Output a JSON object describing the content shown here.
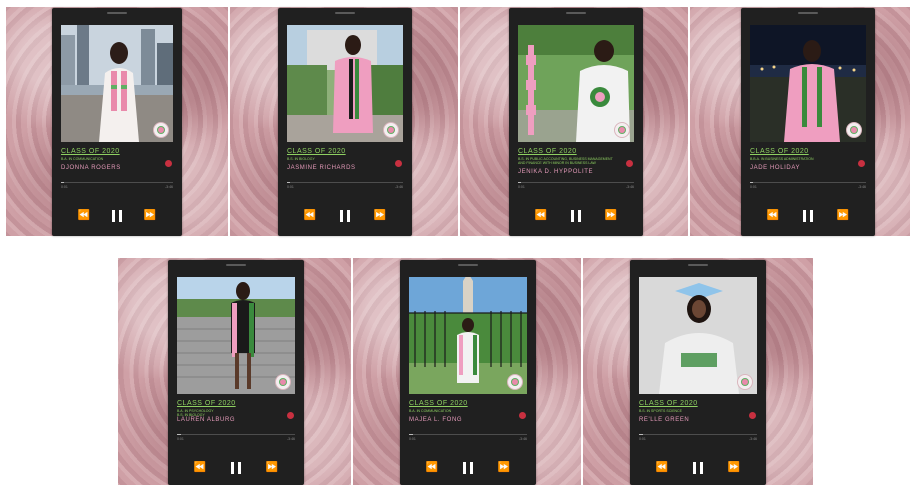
{
  "colors": {
    "accent_green": "#8ed061",
    "accent_pink": "#e39ab9",
    "player_background": "#202020",
    "record_dot": "#c83040"
  },
  "icons": {
    "previous": "⏪",
    "pause": "pause-icon",
    "next": "⏩",
    "record": "record-icon",
    "crest": "sorority-crest-icon"
  },
  "cards": [
    {
      "class_label": "CLASS OF 2020",
      "degree": "B.A. IN COMMUNICATION",
      "name": "DJONNA ROGERS",
      "time_elapsed": "0:01",
      "time_remaining": "-3:46",
      "progress": 0.03
    },
    {
      "class_label": "CLASS OF 2020",
      "degree": "B.S. IN BIOLOGY",
      "name": "JASMINE RICHARDS",
      "time_elapsed": "0:01",
      "time_remaining": "-3:46",
      "progress": 0.03
    },
    {
      "class_label": "CLASS OF 2020",
      "degree": "B.S. IN PUBLIC ACCOUNTING, BUSINESS MANAGEMENT\nAND FINANCE WITH MINOR IN BUSINESS LAW",
      "name": "JENIKA D. HYPPOLITE",
      "time_elapsed": "0:01",
      "time_remaining": "-3:46",
      "progress": 0.03
    },
    {
      "class_label": "CLASS OF 2020",
      "degree": "B.B.A. IN BUSINESS ADMINISTRATION",
      "name": "JADE HOLIDAY",
      "time_elapsed": "0:01",
      "time_remaining": "-3:46",
      "progress": 0.03
    },
    {
      "class_label": "CLASS OF 2020",
      "degree": "B.A. IN PSYCHOLOGY\nB.S. IN BIOLOGY",
      "name": "LAUREN ALBURG",
      "time_elapsed": "0:01",
      "time_remaining": "-3:46",
      "progress": 0.03
    },
    {
      "class_label": "CLASS OF 2020",
      "degree": "B.A. IN COMMUNICATION",
      "name": "MAJEA L. FONG",
      "time_elapsed": "0:01",
      "time_remaining": "-3:46",
      "progress": 0.03
    },
    {
      "class_label": "CLASS OF 2020",
      "degree": "B.S. IN SPORTS SCIENCE",
      "name": "RE'LLE GREEN",
      "time_elapsed": "0:01",
      "time_remaining": "-3:46",
      "progress": 0.03
    }
  ]
}
